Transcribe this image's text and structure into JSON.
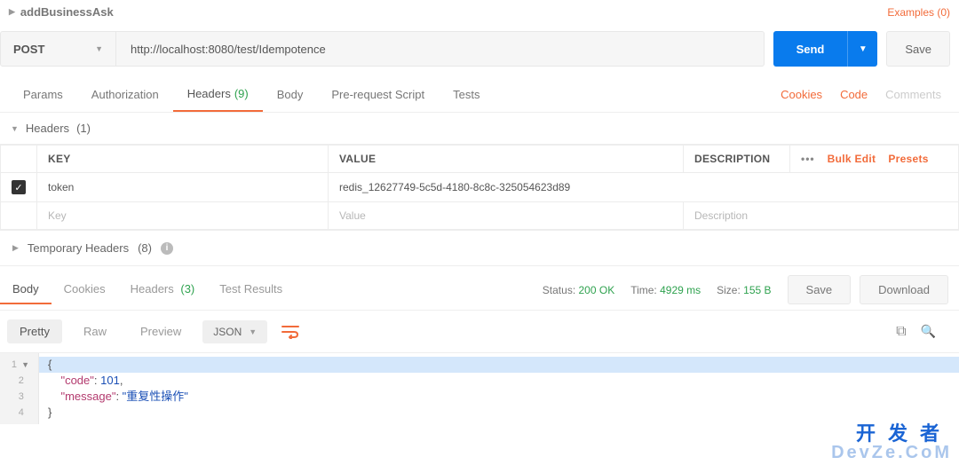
{
  "top": {
    "title": "addBusinessAsk",
    "examples": "Examples (0)"
  },
  "request": {
    "method": "POST",
    "url": "http://localhost:8080/test/Idempotence",
    "send": "Send",
    "save": "Save"
  },
  "reqTabs": {
    "params": "Params",
    "authorization": "Authorization",
    "headers": "Headers",
    "headersCount": "(9)",
    "body": "Body",
    "prerequest": "Pre-request Script",
    "tests": "Tests",
    "cookies": "Cookies",
    "code": "Code",
    "comments": "Comments"
  },
  "headersSection": {
    "title": "Headers",
    "count": "(1)"
  },
  "headersTable": {
    "colKey": "KEY",
    "colValue": "VALUE",
    "colDesc": "DESCRIPTION",
    "bulkEdit": "Bulk Edit",
    "presets": "Presets",
    "rows": [
      {
        "key": "token",
        "value": "redis_12627749-5c5d-4180-8c8c-325054623d89"
      }
    ],
    "placeholderKey": "Key",
    "placeholderValue": "Value",
    "placeholderDesc": "Description"
  },
  "tempHeaders": {
    "title": "Temporary Headers",
    "count": "(8)"
  },
  "respTabs": {
    "body": "Body",
    "cookies": "Cookies",
    "headers": "Headers",
    "headersCount": "(3)",
    "tests": "Test Results"
  },
  "respMeta": {
    "statusLabel": "Status:",
    "statusValue": "200 OK",
    "timeLabel": "Time:",
    "timeValue": "4929 ms",
    "sizeLabel": "Size:",
    "sizeValue": "155 B",
    "save": "Save",
    "download": "Download"
  },
  "viewer": {
    "pretty": "Pretty",
    "raw": "Raw",
    "preview": "Preview",
    "format": "JSON"
  },
  "responseBody": {
    "line1": "{",
    "line2_key": "\"code\"",
    "line2_sep": ": ",
    "line2_val": "101",
    "line2_end": ",",
    "line3_key": "\"message\"",
    "line3_sep": ": ",
    "line3_val": "\"重复性操作\"",
    "line4": "}"
  },
  "chart_data": {
    "type": "table",
    "title": "Response JSON body",
    "columns": [
      "key",
      "value"
    ],
    "rows": [
      {
        "key": "code",
        "value": 101
      },
      {
        "key": "message",
        "value": "重复性操作"
      }
    ]
  },
  "watermark": {
    "cn": "开发者",
    "en": "DevZe.CoM"
  }
}
